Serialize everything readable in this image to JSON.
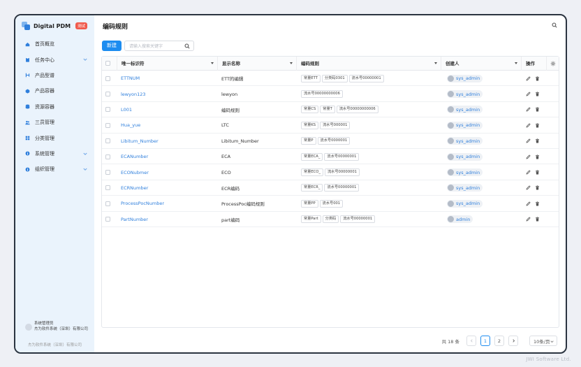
{
  "app": {
    "name": "Digital PDM",
    "badge": "测试"
  },
  "sidebar": {
    "items": [
      {
        "label": "首页概览",
        "icon": "home-icon",
        "expandable": false
      },
      {
        "label": "任务中心",
        "icon": "clipboard-icon",
        "expandable": true
      },
      {
        "label": "产品型谱",
        "icon": "branch-icon",
        "expandable": false
      },
      {
        "label": "产品容器",
        "icon": "cube-icon",
        "expandable": false
      },
      {
        "label": "资源容器",
        "icon": "database-icon",
        "expandable": false
      },
      {
        "label": "三员管理",
        "icon": "users-icon",
        "expandable": false
      },
      {
        "label": "分类管理",
        "icon": "category-icon",
        "expandable": false
      },
      {
        "label": "系统管理",
        "icon": "info-icon",
        "expandable": true
      },
      {
        "label": "组织管理",
        "icon": "info-icon",
        "expandable": true
      }
    ],
    "user": {
      "role": "系统管理员",
      "org": "杰为软件系统（深圳）有限公司"
    },
    "company": "杰为软件系统（深圳）有限公司"
  },
  "header": {
    "title": "编码规则"
  },
  "toolbar": {
    "new_label": "新建",
    "search_placeholder": "请输入搜索关键字"
  },
  "table": {
    "columns": [
      "唯一标识符",
      "显示名称",
      "编码规则",
      "创建人",
      "操作"
    ],
    "rows": [
      {
        "id": "ETTNUM",
        "name": "ETT的编辑",
        "rules": [
          "常量ETT",
          "分类码0301",
          "流水号00000001"
        ],
        "creator": "sys_admin"
      },
      {
        "id": "lewyon123",
        "name": "lewyon",
        "rules": [
          "流水号00000000006"
        ],
        "creator": "sys_admin"
      },
      {
        "id": "L001",
        "name": "编码规则",
        "rules": [
          "常量CS",
          "常量T",
          "流水号00000000006"
        ],
        "creator": "sys_admin"
      },
      {
        "id": "Hua_yue",
        "name": "LTC",
        "rules": [
          "常量KS",
          "流水号000001"
        ],
        "creator": "sys_admin"
      },
      {
        "id": "Libitum_Number",
        "name": "Libitum_Number",
        "rules": [
          "常量P",
          "流水号0000001"
        ],
        "creator": "sys_admin"
      },
      {
        "id": "ECANumber",
        "name": "ECA",
        "rules": [
          "常量ECA_",
          "流水号00000001"
        ],
        "creator": "sys_admin"
      },
      {
        "id": "ECONubmer",
        "name": "ECO",
        "rules": [
          "常量ECO_",
          "流水号00000001"
        ],
        "creator": "sys_admin"
      },
      {
        "id": "ECRNumber",
        "name": "ECR编码",
        "rules": [
          "常量ECR_",
          "流水号00000001"
        ],
        "creator": "sys_admin"
      },
      {
        "id": "ProcessPocNumber",
        "name": "ProcessPoc编码规则",
        "rules": [
          "常量PP",
          "流水号001"
        ],
        "creator": "sys_admin"
      },
      {
        "id": "PartNumber",
        "name": "part编码",
        "rules": [
          "常量Part",
          "分类码",
          "流水号00000001"
        ],
        "creator": "admin"
      }
    ]
  },
  "pagination": {
    "total_text": "共 18 条",
    "pages": [
      "1",
      "2"
    ],
    "current": "1",
    "page_size": "10条/页"
  },
  "brand_footer": "JWI Software Ltd.",
  "colors": {
    "primary": "#1c8cf0",
    "sidebar_bg": "#eaf3fc",
    "link": "#2f7fdc",
    "badge": "#f05a4c"
  }
}
